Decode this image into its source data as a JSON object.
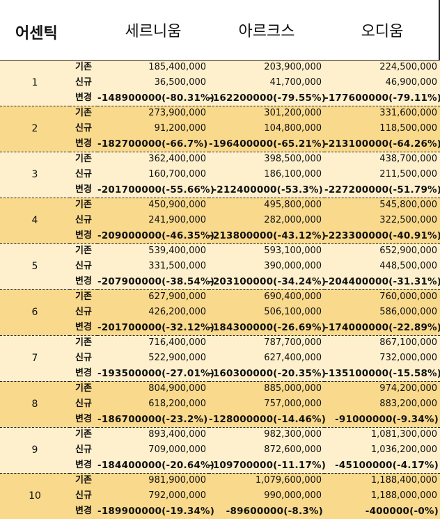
{
  "header": {
    "corner_label": "어센틱",
    "columns": [
      "세르니움",
      "아르크스",
      "오디움"
    ]
  },
  "row_labels": {
    "base": "기존",
    "new": "신규",
    "change": "변경"
  },
  "levels": [
    {
      "level": "1",
      "base": [
        "185,400,000",
        "203,900,000",
        "224,500,000"
      ],
      "new": [
        "36,500,000",
        "41,700,000",
        "46,900,000"
      ],
      "change": [
        "-148900000(-80.31%)",
        "-162200000(-79.55%)",
        "-177600000(-79.11%)"
      ]
    },
    {
      "level": "2",
      "base": [
        "273,900,000",
        "301,200,000",
        "331,600,000"
      ],
      "new": [
        "91,200,000",
        "104,800,000",
        "118,500,000"
      ],
      "change": [
        "-182700000(-66.7%)",
        "-196400000(-65.21%)",
        "-213100000(-64.26%)"
      ]
    },
    {
      "level": "3",
      "base": [
        "362,400,000",
        "398,500,000",
        "438,700,000"
      ],
      "new": [
        "160,700,000",
        "186,100,000",
        "211,500,000"
      ],
      "change": [
        "-201700000(-55.66%)",
        "-212400000(-53.3%)",
        "-227200000(-51.79%)"
      ]
    },
    {
      "level": "4",
      "base": [
        "450,900,000",
        "495,800,000",
        "545,800,000"
      ],
      "new": [
        "241,900,000",
        "282,000,000",
        "322,500,000"
      ],
      "change": [
        "-209000000(-46.35%)",
        "-213800000(-43.12%)",
        "-223300000(-40.91%)"
      ]
    },
    {
      "level": "5",
      "base": [
        "539,400,000",
        "593,100,000",
        "652,900,000"
      ],
      "new": [
        "331,500,000",
        "390,000,000",
        "448,500,000"
      ],
      "change": [
        "-207900000(-38.54%)",
        "-203100000(-34.24%)",
        "-204400000(-31.31%)"
      ]
    },
    {
      "level": "6",
      "base": [
        "627,900,000",
        "690,400,000",
        "760,000,000"
      ],
      "new": [
        "426,200,000",
        "506,100,000",
        "586,000,000"
      ],
      "change": [
        "-201700000(-32.12%)",
        "-184300000(-26.69%)",
        "-174000000(-22.89%)"
      ]
    },
    {
      "level": "7",
      "base": [
        "716,400,000",
        "787,700,000",
        "867,100,000"
      ],
      "new": [
        "522,900,000",
        "627,400,000",
        "732,000,000"
      ],
      "change": [
        "-193500000(-27.01%)",
        "-160300000(-20.35%)",
        "-135100000(-15.58%)"
      ]
    },
    {
      "level": "8",
      "base": [
        "804,900,000",
        "885,000,000",
        "974,200,000"
      ],
      "new": [
        "618,200,000",
        "757,000,000",
        "883,200,000"
      ],
      "change": [
        "-186700000(-23.2%)",
        "-128000000(-14.46%)",
        "-91000000(-9.34%)"
      ]
    },
    {
      "level": "9",
      "base": [
        "893,400,000",
        "982,300,000",
        "1,081,300,000"
      ],
      "new": [
        "709,000,000",
        "872,600,000",
        "1,036,200,000"
      ],
      "change": [
        "-184400000(-20.64%)",
        "-109700000(-11.17%)",
        "-45100000(-4.17%)"
      ]
    },
    {
      "level": "10",
      "base": [
        "981,900,000",
        "1,079,600,000",
        "1,188,400,000"
      ],
      "new": [
        "792,000,000",
        "990,000,000",
        "1,188,000,000"
      ],
      "change": [
        "-189900000(-19.34%)",
        "-89600000(-8.3%)",
        "-400000(-0%)"
      ]
    }
  ],
  "colors": {
    "band_light": "#fef0cc",
    "band_dark": "#f9d98b",
    "text": "#111111"
  }
}
